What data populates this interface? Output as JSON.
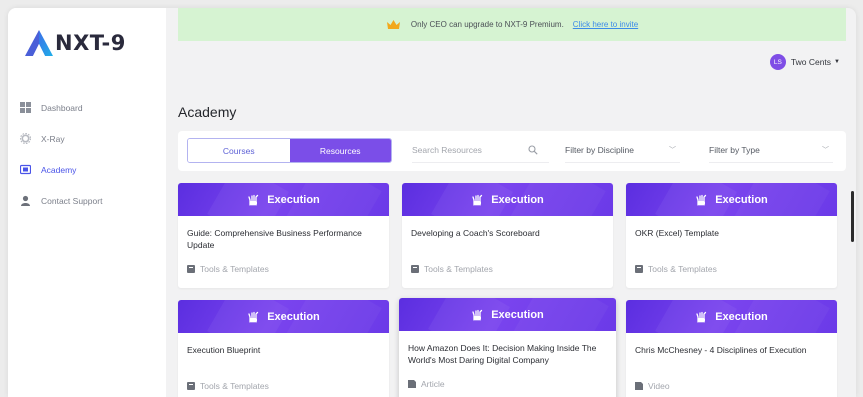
{
  "app": {
    "logo_text": "NXT-9"
  },
  "sidebar": {
    "items": [
      {
        "label": "Dashboard",
        "icon": "grid-icon",
        "active": false
      },
      {
        "label": "X-Ray",
        "icon": "gear-icon",
        "active": false
      },
      {
        "label": "Academy",
        "icon": "academy-icon",
        "active": true
      },
      {
        "label": "Contact Support",
        "icon": "support-icon",
        "active": false
      }
    ]
  },
  "banner": {
    "text": "Only CEO can upgrade to NXT-9 Premium.",
    "link": "Click here to invite",
    "icon": "crown-icon"
  },
  "user": {
    "initials": "LS",
    "name": "Two Cents"
  },
  "page": {
    "title": "Academy"
  },
  "filters": {
    "tabs": [
      {
        "label": "Courses",
        "active": false
      },
      {
        "label": "Resources",
        "active": true
      }
    ],
    "search_placeholder": "Search Resources",
    "discipline": "Filter by Discipline",
    "type": "Filter by Type"
  },
  "cards": [
    {
      "category": "Execution",
      "title": "Guide: Comprehensive Business Performance Update",
      "kind": "Tools & Templates",
      "kind_icon": "template-icon"
    },
    {
      "category": "Execution",
      "title": "Developing a Coach's Scoreboard",
      "kind": "Tools & Templates",
      "kind_icon": "template-icon"
    },
    {
      "category": "Execution",
      "title": "OKR (Excel) Template",
      "kind": "Tools & Templates",
      "kind_icon": "template-icon"
    },
    {
      "category": "Execution",
      "title": "Execution Blueprint",
      "kind": "Tools & Templates",
      "kind_icon": "template-icon"
    },
    {
      "category": "Execution",
      "title": "How Amazon Does It: Decision Making Inside The World's Most Daring Digital Company",
      "kind": "Article",
      "kind_icon": "article-icon"
    },
    {
      "category": "Execution",
      "title": "Chris McChesney - 4 Disciplines of Execution",
      "kind": "Video",
      "kind_icon": "video-icon"
    }
  ],
  "colors": {
    "accent": "#7b4ee8",
    "nav_active": "#4a54e8",
    "banner_bg": "#d6f3d2",
    "link": "#3c8be8"
  }
}
